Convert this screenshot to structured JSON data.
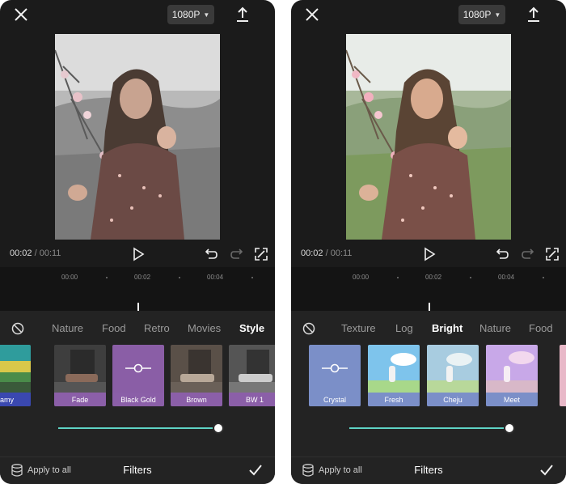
{
  "left": {
    "resolution": "1080P",
    "time_current": "00:02",
    "time_total": "/ 00:11",
    "ticks": [
      "00:00",
      "00:02",
      "00:04"
    ],
    "tabs": [
      "Nature",
      "Food",
      "Retro",
      "Movies",
      "Style"
    ],
    "active_tab": "Style",
    "filters": [
      "eamy",
      "Fade",
      "Black Gold",
      "Brown",
      "BW 1"
    ],
    "selected_filter": "Black Gold",
    "intensity": 1.0,
    "apply_all": "Apply to all",
    "panel_title": "Filters",
    "preview_tone": "desaturated"
  },
  "right": {
    "resolution": "1080P",
    "time_current": "00:02",
    "time_total": "/ 00:11",
    "ticks": [
      "00:00",
      "00:02",
      "00:04"
    ],
    "tabs": [
      "Texture",
      "Log",
      "Bright",
      "Nature",
      "Food"
    ],
    "active_tab": "Bright",
    "filters": [
      "Crystal",
      "Fresh",
      "Cheju",
      "Meet"
    ],
    "selected_filter": "Crystal",
    "intensity": 1.0,
    "apply_all": "Apply to all",
    "panel_title": "Filters",
    "preview_tone": "bright"
  },
  "colors": {
    "accent_slider": "#5ed3c5",
    "selected_filter_left": "#8a5ea6",
    "selected_filter_right": "#7b8fc8"
  },
  "icons": [
    "close-icon",
    "chevron-down-icon",
    "export-icon",
    "play-icon",
    "undo-icon",
    "redo-icon",
    "fullscreen-icon",
    "no-filter-icon",
    "slider-adjust-icon",
    "layers-icon",
    "check-icon"
  ]
}
